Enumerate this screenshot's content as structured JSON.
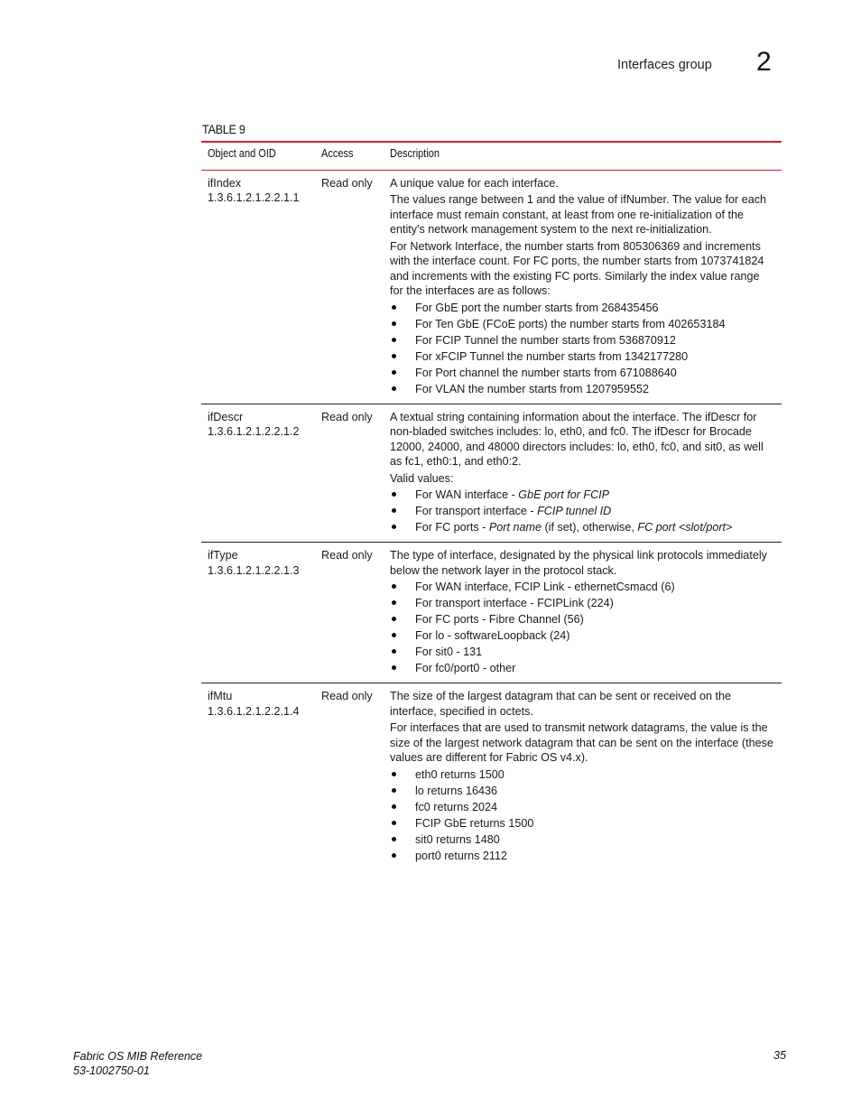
{
  "header": {
    "section_title": "Interfaces group",
    "chapter_number": "2"
  },
  "table": {
    "caption": "TABLE 9",
    "columns": [
      "Object and OID",
      "Access",
      "Description"
    ],
    "rows": [
      {
        "object": "ifIndex",
        "oid": "1.3.6.1.2.1.2.2.1.1",
        "access": "Read only",
        "paragraphs": [
          "A unique value for each interface.",
          "The values range between 1 and the value of ifNumber. The value for each interface must remain constant, at least from one re-initialization of the entity's network management system to the next re-initialization.",
          "For Network Interface, the number starts from 805306369 and increments with the interface count. For FC ports, the number starts from 1073741824 and increments with the existing FC ports. Similarly the index value range for the interfaces are as follows:"
        ],
        "bullets": [
          "For GbE port the number starts from 268435456",
          "For Ten GbE (FCoE ports) the number starts from 402653184",
          "For FCIP Tunnel the number starts from 536870912",
          "For xFCIP Tunnel the number starts from 1342177280",
          "For Port channel the number starts from 671088640",
          "For VLAN the number starts from 1207959552"
        ]
      },
      {
        "object": "ifDescr",
        "oid": "1.3.6.1.2.1.2.2.1.2",
        "access": "Read only",
        "paragraphs": [
          "A textual string containing information about the interface. The ifDescr for non-bladed switches includes: lo, eth0, and fc0. The ifDescr for Brocade 12000, 24000, and 48000 directors includes: lo, eth0, fc0, and sit0, as well as fc1, eth0:1, and eth0:2.",
          "Valid values:"
        ],
        "bullets_rich": [
          {
            "prefix": "For WAN interface - ",
            "italic1": "GbE port for FCIP",
            "middle": "",
            "italic2": ""
          },
          {
            "prefix": "For transport interface - ",
            "italic1": "FCIP tunnel ID",
            "middle": "",
            "italic2": ""
          },
          {
            "prefix": "For FC ports - ",
            "italic1": "Port name",
            "middle": " (if set), otherwise, ",
            "italic2": "FC port <slot/port>"
          }
        ]
      },
      {
        "object": "ifType",
        "oid": "1.3.6.1.2.1.2.2.1.3",
        "access": "Read only",
        "paragraphs": [
          "The type of interface, designated by the physical link protocols immediately below the network layer in the protocol stack."
        ],
        "bullets": [
          "For WAN interface, FCIP Link - ethernetCsmacd (6)",
          "For transport interface - FCIPLink (224)",
          "For FC ports - Fibre Channel (56)",
          "For lo - softwareLoopback (24)",
          "For sit0 - 131",
          "For fc0/port0 - other"
        ]
      },
      {
        "object": "ifMtu",
        "oid": "1.3.6.1.2.1.2.2.1.4",
        "access": "Read only",
        "paragraphs": [
          "The size of the largest datagram that can be sent or received on the interface, specified in octets.",
          "For interfaces that are used to transmit network datagrams, the value is the size of the largest network datagram that can be sent on the interface (these values are different for Fabric OS v4.x)."
        ],
        "bullets": [
          "eth0 returns 1500",
          "lo returns 16436",
          "fc0 returns 2024",
          "FCIP GbE returns 1500",
          "sit0 returns 1480",
          "port0 returns 2112"
        ]
      }
    ]
  },
  "footer": {
    "book_title": "Fabric OS MIB Reference",
    "doc_number": "53-1002750-01",
    "page_number": "35"
  },
  "colors": {
    "table_rule": "#d31f2e",
    "row_divider": "#222222",
    "text": "#1a1a1a"
  }
}
